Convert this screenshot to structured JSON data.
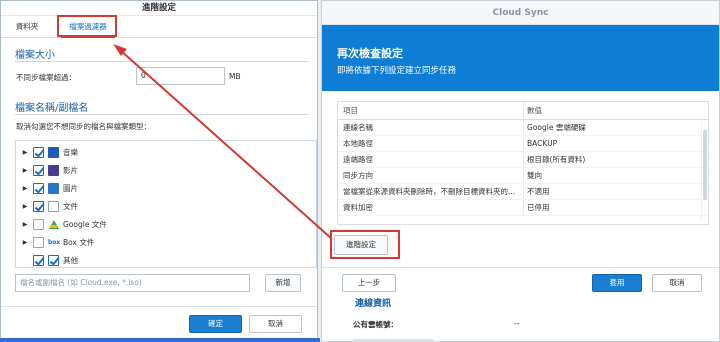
{
  "cloud_sync": {
    "window_title": "Cloud Sync",
    "header_title": "再次檢查設定",
    "header_subtitle": "即將依據下列設定建立同步任務",
    "table": {
      "col_item": "項目",
      "col_value": "數值",
      "rows": [
        {
          "item": "連線名稱",
          "value": "Google 雲端硬碟"
        },
        {
          "item": "本地路徑",
          "value": "BACKUP"
        },
        {
          "item": "遠端路徑",
          "value": "根目錄(所有資料)"
        },
        {
          "item": "同步方向",
          "value": "雙向"
        },
        {
          "item": "當檔案從來源資料夾刪除時，不刪除目標資料夾的...",
          "value": "不適用"
        },
        {
          "item": "資料加密",
          "value": "已停用"
        }
      ]
    },
    "advanced_button": "進階設定",
    "back_button": "上一步",
    "apply_button": "套用",
    "cancel_button": "取消",
    "conn_title": "連線資訊",
    "public_link_label": "公有雲帳號：",
    "public_link_value": "--"
  },
  "advanced": {
    "window_title": "進階設定",
    "tabs": [
      "資料夾",
      "檔案過濾器"
    ],
    "size_section": "檔案大小",
    "size_label": "不同步檔案超過：",
    "size_value": "0",
    "size_unit": "MB",
    "ext_section": "檔案名稱/副檔名",
    "ext_hint": "取消勾選您不想同步的檔名與檔案類型：",
    "file_types": [
      {
        "label": "音樂",
        "checked": true,
        "icon": "music-icon"
      },
      {
        "label": "影片",
        "checked": true,
        "icon": "video-icon"
      },
      {
        "label": "圖片",
        "checked": true,
        "icon": "image-icon"
      },
      {
        "label": "文件",
        "checked": true,
        "icon": "document-icon"
      },
      {
        "label": "Google 文件",
        "checked": false,
        "icon": "google-docs-icon"
      },
      {
        "label": "Box 文件",
        "checked": false,
        "icon": "box-icon"
      },
      {
        "label": "其他",
        "checked": true,
        "icon": ""
      }
    ],
    "box_icon_text": "box",
    "ext_placeholder": "檔名或副檔名 (如 Cloud.exe, *.iso)",
    "add_button": "新增",
    "ok_button": "確定",
    "cancel_button": "取消"
  },
  "colors": {
    "accent": "#1a7fd0",
    "header_blue": "#0e7dd3",
    "highlight_red": "#d43a32"
  }
}
